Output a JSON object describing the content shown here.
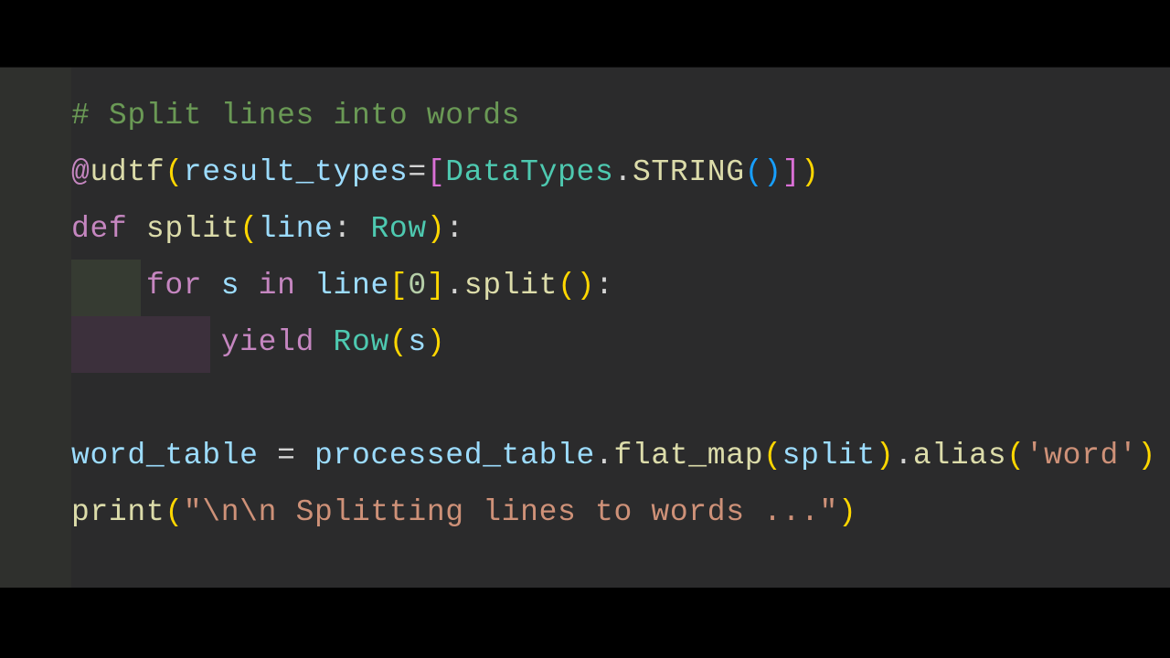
{
  "code": {
    "comment": "# Split lines into words",
    "decorator_at": "@",
    "decorator_name": "udtf",
    "decorator_open": "(",
    "result_types_key": "result_types",
    "equals": "=",
    "bracket_open": "[",
    "data_types": "DataTypes",
    "dot": ".",
    "string_fn": "STRING",
    "paren_open3": "(",
    "paren_close3": ")",
    "bracket_close": "]",
    "decorator_close": ")",
    "kw_def": "def",
    "fn_split": "split",
    "fn_paren_open": "(",
    "param_line": "line",
    "colon": ":",
    "type_row": "Row",
    "fn_paren_close": ")",
    "fn_colon": ":",
    "indent1": "    ",
    "kw_for": "for",
    "var_s": "s",
    "kw_in": "in",
    "line_idx": "line",
    "idx_open": "[",
    "idx_num": "0",
    "idx_close": "]",
    "split_call": "split",
    "split_open": "(",
    "split_close": ")",
    "for_colon": ":",
    "indent2": "        ",
    "kw_yield": "yield",
    "row_call": "Row",
    "row_open": "(",
    "row_arg": "s",
    "row_close": ")",
    "word_table": "word_table",
    "assign": " = ",
    "processed_table": "processed_table",
    "flat_map": "flat_map",
    "fm_open": "(",
    "fm_arg": "split",
    "fm_close": ")",
    "alias": "alias",
    "alias_open": "(",
    "alias_str": "'word'",
    "alias_close": ")",
    "print_fn": "print",
    "print_open": "(",
    "print_str": "\"\\n\\n Splitting lines to words ...\"",
    "print_close": ")",
    "space": " "
  }
}
